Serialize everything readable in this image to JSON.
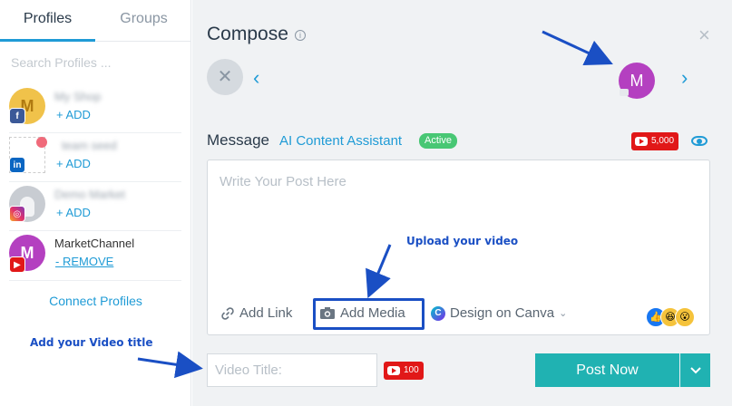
{
  "sidebar": {
    "tabs": [
      {
        "label": "Profiles"
      },
      {
        "label": "Groups"
      }
    ],
    "search_placeholder": "Search Profiles ...",
    "profiles": [
      {
        "name": "My Shop",
        "action": "+ ADD",
        "network_icon": "facebook-icon",
        "avatar_letter": "M",
        "avatar_color": "#f0c24a"
      },
      {
        "name": "team seed",
        "action": "+ ADD",
        "network_icon": "linkedin-icon",
        "avatar_letter": "",
        "avatar_color": "#ffffff"
      },
      {
        "name": "Demo Market",
        "action": "+ ADD",
        "network_icon": "instagram-icon",
        "avatar_letter": "",
        "avatar_color": "#c8ccd2"
      },
      {
        "name": "MarketChannel",
        "action": "- REMOVE",
        "network_icon": "youtube-icon",
        "avatar_letter": "M",
        "avatar_color": "#b440c0"
      }
    ],
    "connect_label": "Connect Profiles"
  },
  "compose": {
    "title": "Compose",
    "selected_avatar_letter": "M",
    "message_label": "Message",
    "ai_assistant_label": "AI Content Assistant",
    "active_badge": "Active",
    "char_limit": "5,000",
    "message_placeholder": "Write Your Post Here",
    "toolbar": {
      "add_link": "Add Link",
      "add_media": "Add Media",
      "design_canva": "Design on Canva"
    },
    "video_title_placeholder": "Video Title:",
    "video_title_limit": "100",
    "post_button": "Post Now"
  },
  "annotations": {
    "upload_video": "Upload your video",
    "add_video_title": "Add your Video title"
  },
  "colors": {
    "accent": "#1f9bd6",
    "post_button": "#20b2b2",
    "youtube_red": "#e11818",
    "annotation_blue": "#1a4fc4"
  }
}
